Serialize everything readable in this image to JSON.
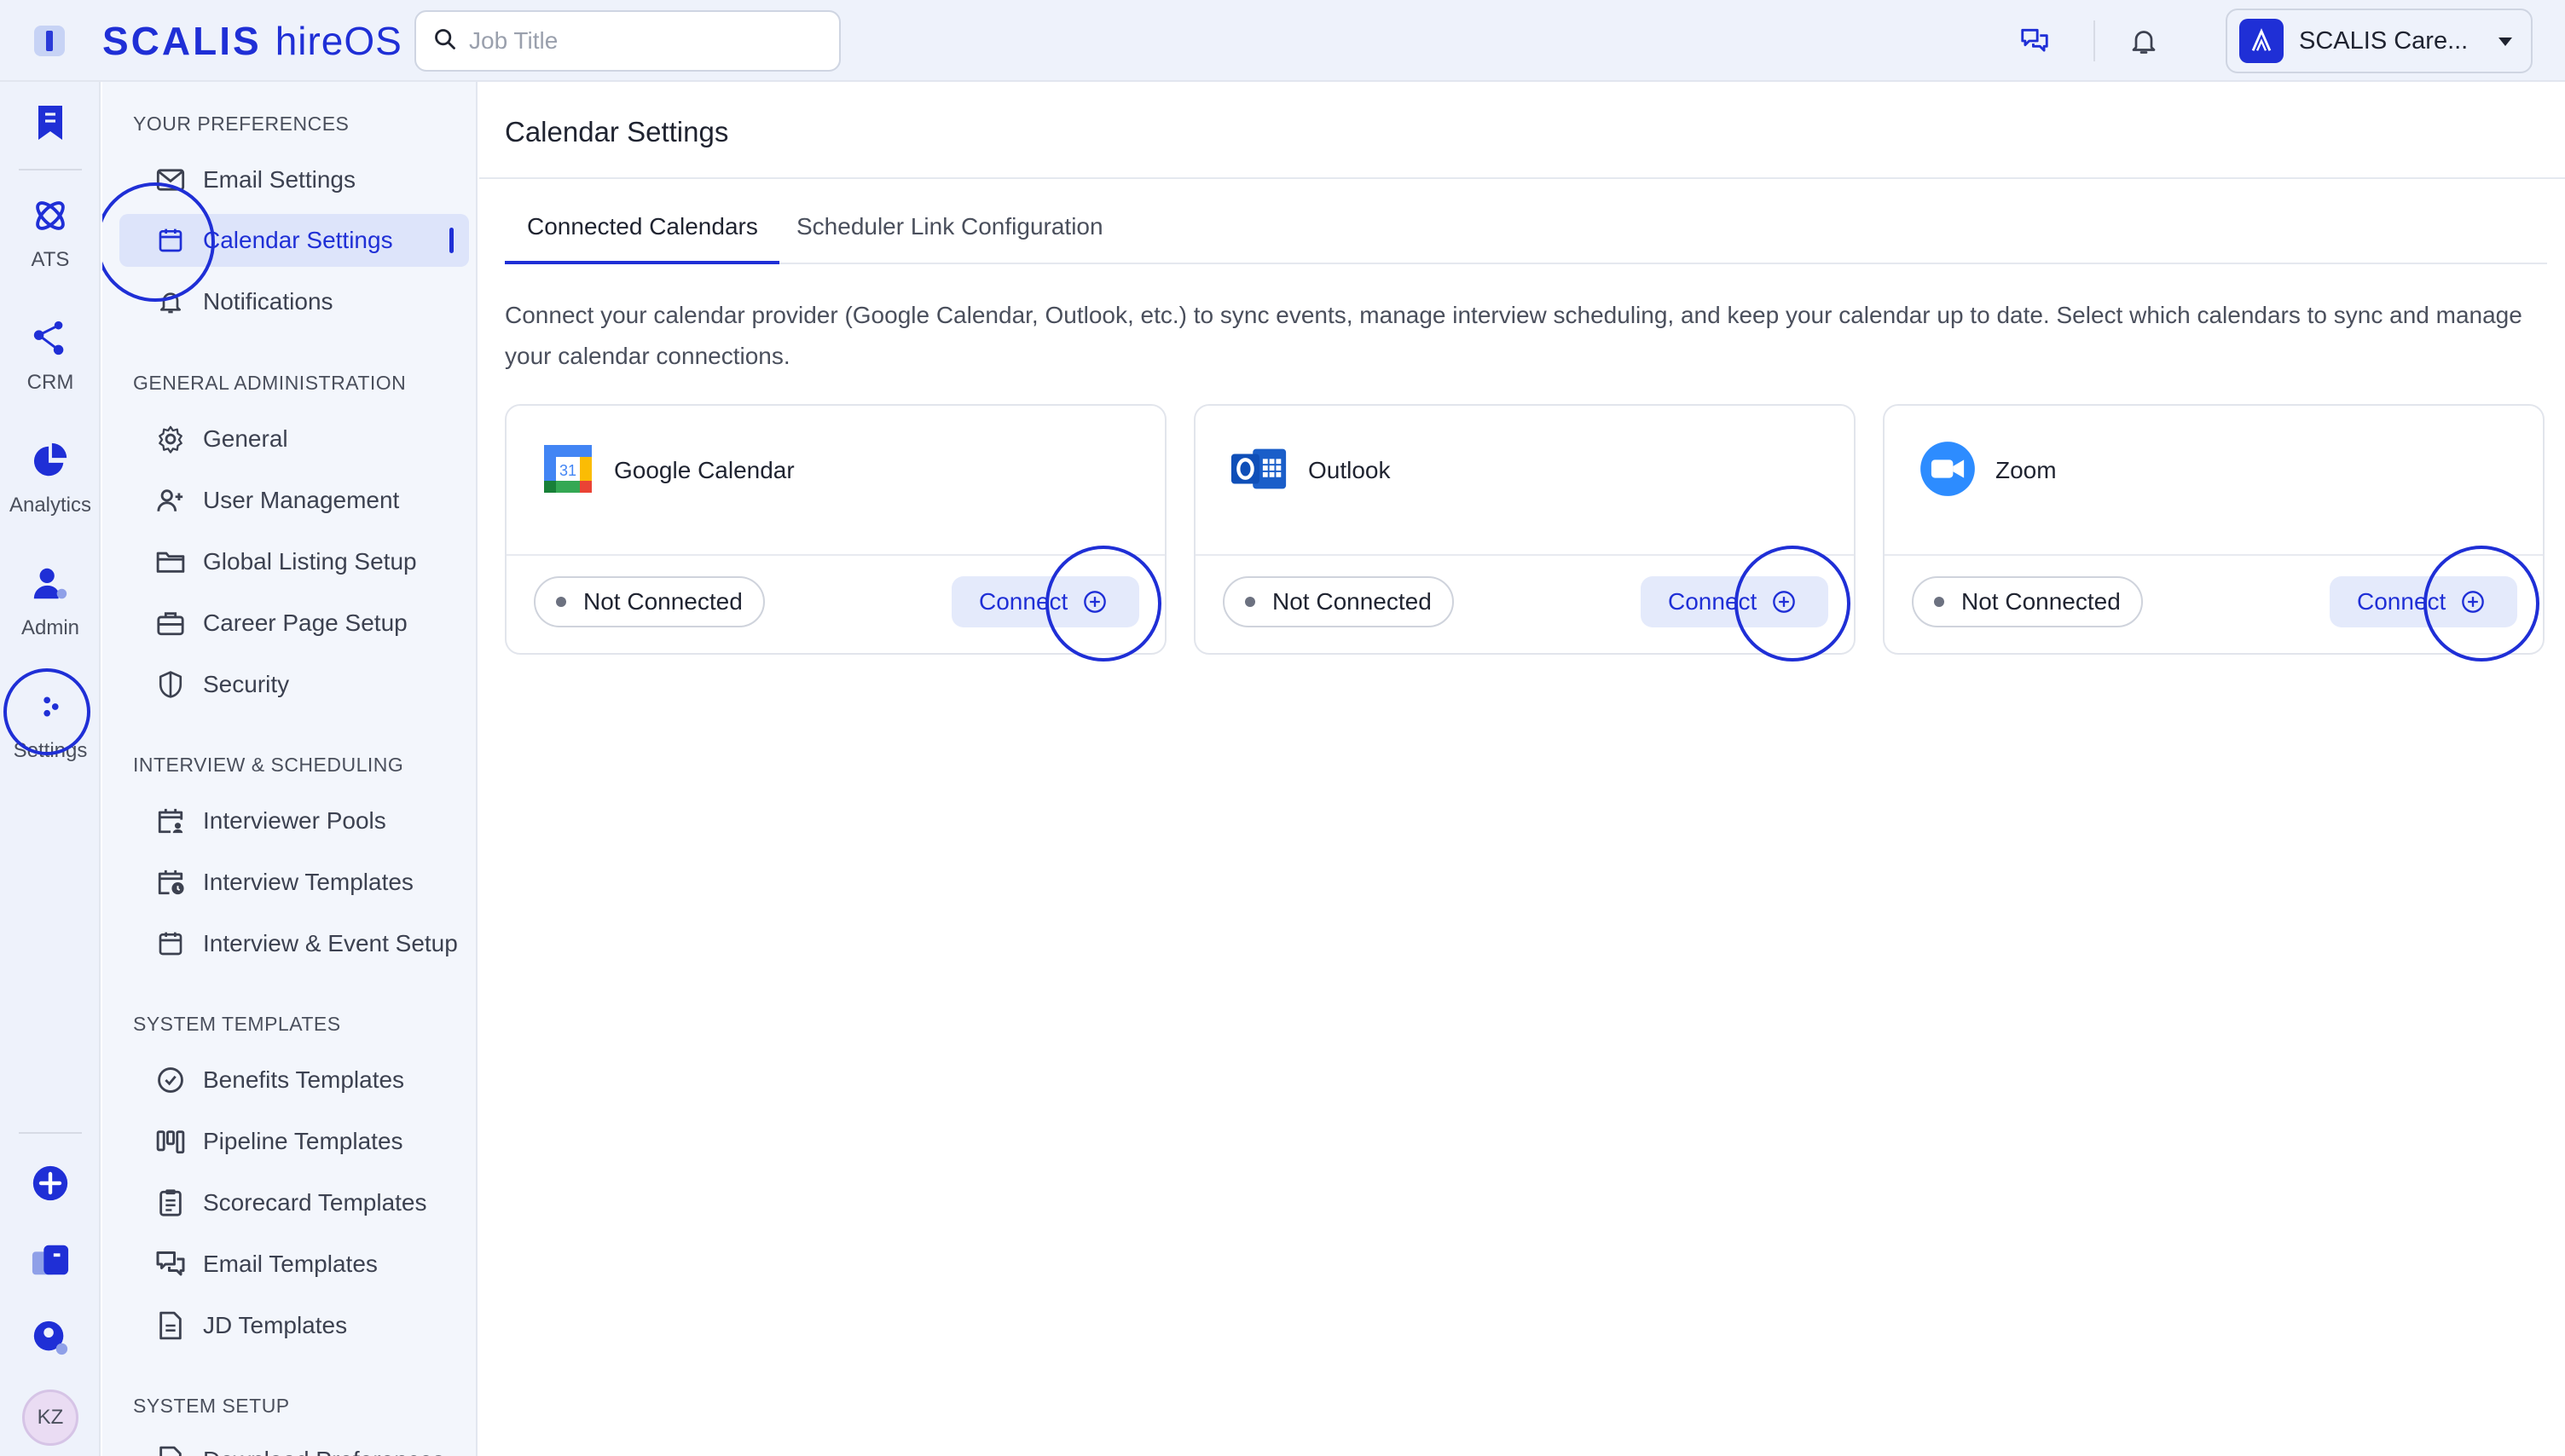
{
  "app": {
    "logo_brand": "SCALIS",
    "logo_product": "hireOS"
  },
  "topbar": {
    "search_placeholder": "Job Title",
    "account_name": "SCALIS Care..."
  },
  "rail": {
    "items": [
      {
        "label": ""
      },
      {
        "label": "ATS"
      },
      {
        "label": "CRM"
      },
      {
        "label": "Analytics"
      },
      {
        "label": "Admin"
      },
      {
        "label": "Settings"
      }
    ],
    "avatar_initials": "KZ"
  },
  "sidebar": {
    "sections": [
      {
        "title": "YOUR PREFERENCES",
        "items": [
          "Email Settings",
          "Calendar Settings",
          "Notifications"
        ]
      },
      {
        "title": "GENERAL ADMINISTRATION",
        "items": [
          "General",
          "User Management",
          "Global Listing Setup",
          "Career Page Setup",
          "Security"
        ]
      },
      {
        "title": "INTERVIEW & SCHEDULING",
        "items": [
          "Interviewer Pools",
          "Interview Templates",
          "Interview & Event Setup"
        ]
      },
      {
        "title": "SYSTEM TEMPLATES",
        "items": [
          "Benefits Templates",
          "Pipeline Templates",
          "Scorecard Templates",
          "Email Templates",
          "JD Templates"
        ]
      },
      {
        "title": "SYSTEM SETUP",
        "items": [
          "Download Preferences"
        ]
      }
    ],
    "active_item": "Calendar Settings"
  },
  "main": {
    "title": "Calendar Settings",
    "tabs": [
      {
        "label": "Connected Calendars",
        "active": true
      },
      {
        "label": "Scheduler Link Configuration",
        "active": false
      }
    ],
    "description": "Connect your calendar provider (Google Calendar, Outlook, etc.) to sync events, manage interview scheduling, and keep your calendar up to date. Select which calendars to sync and manage your calendar connections.",
    "providers": [
      {
        "name": "Google Calendar",
        "icon": "google-calendar-icon",
        "status": "Not Connected",
        "action": "Connect"
      },
      {
        "name": "Outlook",
        "icon": "outlook-icon",
        "status": "Not Connected",
        "action": "Connect"
      },
      {
        "name": "Zoom",
        "icon": "zoom-icon",
        "status": "Not Connected",
        "action": "Connect"
      }
    ]
  },
  "colors": {
    "accent": "#1f2fd6",
    "sidebar_bg": "#f3f6fc",
    "rail_bg": "#eef2fb",
    "active_bg": "#dde4fa"
  }
}
